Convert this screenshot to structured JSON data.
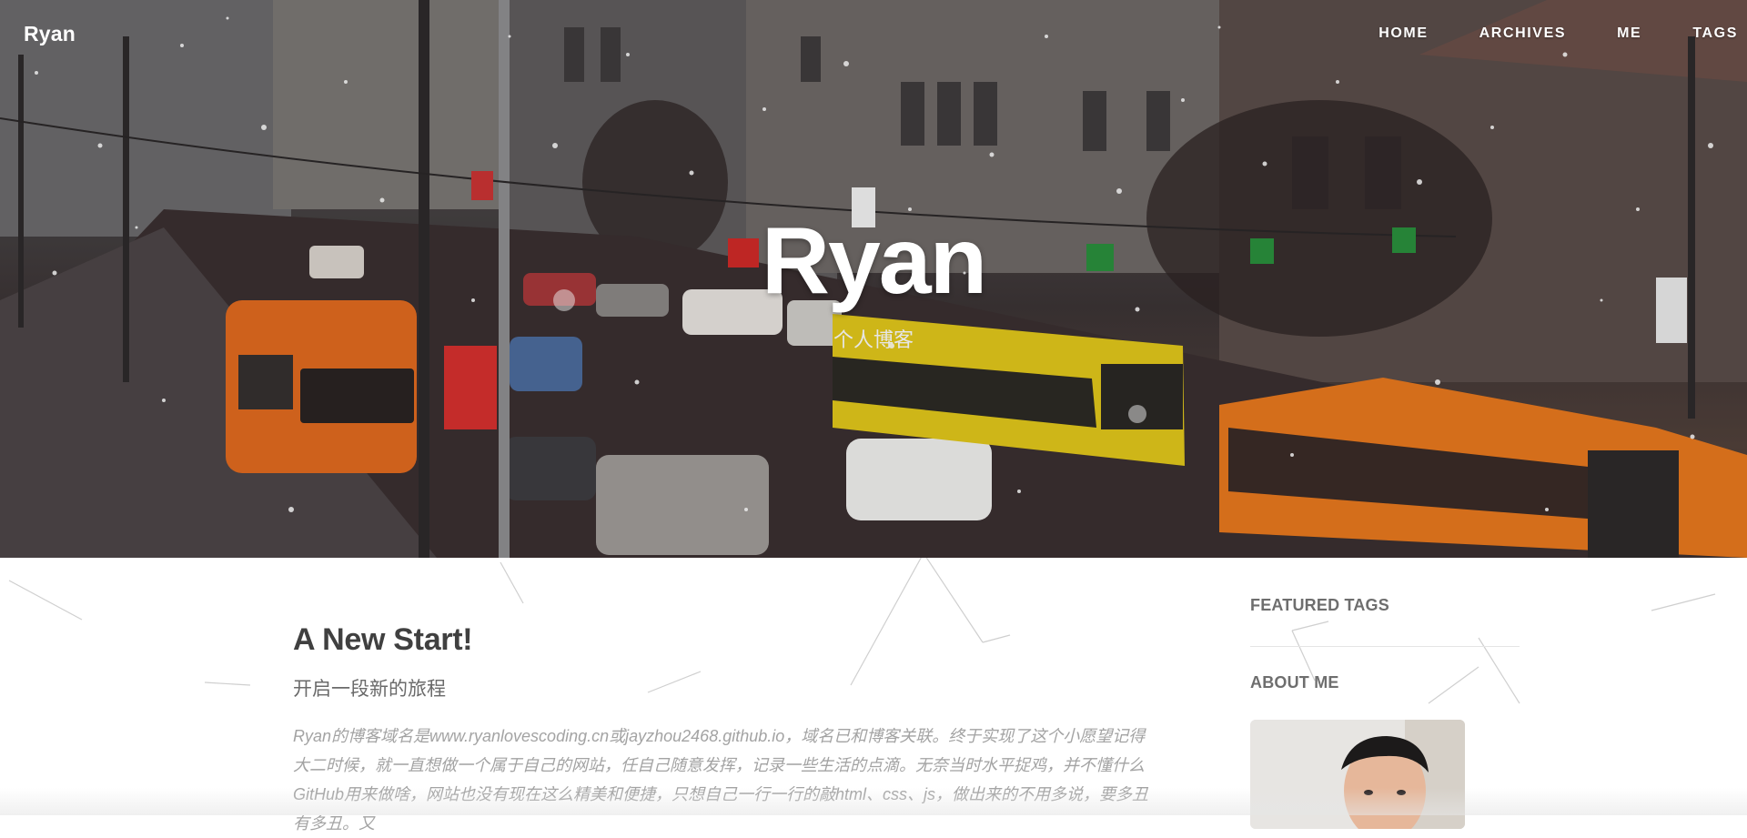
{
  "brand": "Ryan",
  "nav": {
    "items": [
      "HOME",
      "ARCHIVES",
      "ME",
      "TAGS"
    ]
  },
  "hero": {
    "title": "Ryan",
    "subtitle": "个人博客"
  },
  "post": {
    "title": "A New Start!",
    "subtitle": "开启一段新的旅程",
    "excerpt": "Ryan的博客域名是www.ryanlovescoding.cn或jayzhou2468.github.io，域名已和博客关联。终于实现了这个小愿望记得大二时候，就一直想做一个属于自己的网站，任自己随意发挥，记录一些生活的点滴。无奈当时水平捉鸡，并不懂什么GitHub用来做啥，网站也没有现在这么精美和便捷，只想自己一行一行的敲html、css、js，做出来的不用多说，要多丑有多丑。又"
  },
  "sidebar": {
    "featured_tags_heading": "FEATURED TAGS",
    "about_me_heading": "ABOUT ME"
  }
}
